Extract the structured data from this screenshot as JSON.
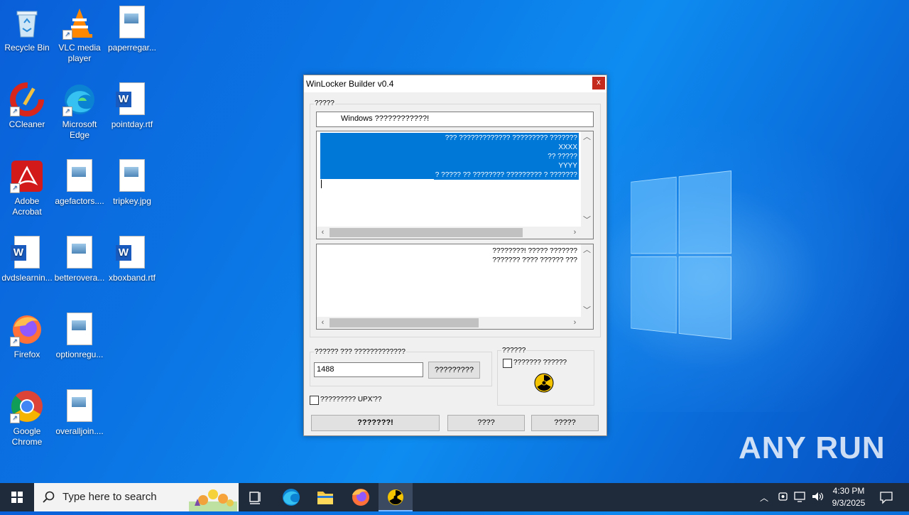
{
  "desktop_icons": [
    {
      "label": "Recycle Bin",
      "icon": "recycle-bin-icon"
    },
    {
      "label": "VLC media player",
      "icon": "vlc-icon"
    },
    {
      "label": "paperregar...",
      "icon": "image-file-icon"
    },
    {
      "label": "CCleaner",
      "icon": "ccleaner-icon"
    },
    {
      "label": "Microsoft Edge",
      "icon": "edge-icon"
    },
    {
      "label": "pointday.rtf",
      "icon": "word-doc-icon"
    },
    {
      "label": "Adobe Acrobat",
      "icon": "acrobat-icon"
    },
    {
      "label": "agefactors....",
      "icon": "image-file-icon"
    },
    {
      "label": "tripkey.jpg",
      "icon": "image-file-icon"
    },
    {
      "label": "dvdslearnin...",
      "icon": "word-doc-icon"
    },
    {
      "label": "betterovera...",
      "icon": "image-file-icon"
    },
    {
      "label": "xboxband.rtf",
      "icon": "word-doc-icon"
    },
    {
      "label": "Firefox",
      "icon": "firefox-icon"
    },
    {
      "label": "optionregu...",
      "icon": "image-file-icon"
    },
    {
      "label": "Google Chrome",
      "icon": "chrome-icon"
    },
    {
      "label": "overalljoin....",
      "icon": "image-file-icon"
    }
  ],
  "dialog": {
    "title": "WinLocker Builder v0.4",
    "close_label": "x",
    "group1_label": "?????",
    "title_field_value": "Windows ????????????!",
    "memo1_lines": [
      "??? ????????????? ????????? ???????",
      "XXXX",
      "?? ?????",
      "YYYY",
      "? ????? ?? ???????? ????????? ? ???????"
    ],
    "memo2_lines": [
      "????????! ????? ???????",
      "??????? ???? ?????? ???"
    ],
    "code_group_label": "?????? ??? ?????????????",
    "code_value": "1488",
    "generate_button": "?????????",
    "options_group_label": "??????",
    "options_checkbox_label": "??????? ??????",
    "upx_checkbox_label": "????????? UPX'??",
    "create_button": "???????!",
    "test_button": "????",
    "exit_button": "?????"
  },
  "taskbar": {
    "search_placeholder": "Type here to search",
    "time": "4:30 PM",
    "date": "9/3/2025"
  },
  "watermark": "ANY RUN",
  "colors": {
    "accent": "#0078d7",
    "close": "#c42b1c",
    "taskbar": "#1f2a3a"
  }
}
